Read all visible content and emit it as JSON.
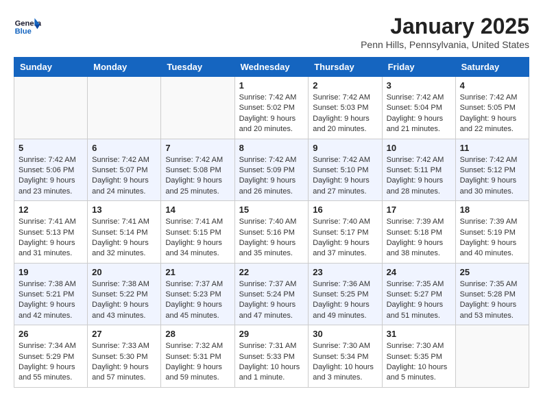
{
  "header": {
    "logo_line1": "General",
    "logo_line2": "Blue",
    "month": "January 2025",
    "location": "Penn Hills, Pennsylvania, United States"
  },
  "weekdays": [
    "Sunday",
    "Monday",
    "Tuesday",
    "Wednesday",
    "Thursday",
    "Friday",
    "Saturday"
  ],
  "weeks": [
    [
      {
        "day": "",
        "info": ""
      },
      {
        "day": "",
        "info": ""
      },
      {
        "day": "",
        "info": ""
      },
      {
        "day": "1",
        "info": "Sunrise: 7:42 AM\nSunset: 5:02 PM\nDaylight: 9 hours\nand 20 minutes."
      },
      {
        "day": "2",
        "info": "Sunrise: 7:42 AM\nSunset: 5:03 PM\nDaylight: 9 hours\nand 20 minutes."
      },
      {
        "day": "3",
        "info": "Sunrise: 7:42 AM\nSunset: 5:04 PM\nDaylight: 9 hours\nand 21 minutes."
      },
      {
        "day": "4",
        "info": "Sunrise: 7:42 AM\nSunset: 5:05 PM\nDaylight: 9 hours\nand 22 minutes."
      }
    ],
    [
      {
        "day": "5",
        "info": "Sunrise: 7:42 AM\nSunset: 5:06 PM\nDaylight: 9 hours\nand 23 minutes."
      },
      {
        "day": "6",
        "info": "Sunrise: 7:42 AM\nSunset: 5:07 PM\nDaylight: 9 hours\nand 24 minutes."
      },
      {
        "day": "7",
        "info": "Sunrise: 7:42 AM\nSunset: 5:08 PM\nDaylight: 9 hours\nand 25 minutes."
      },
      {
        "day": "8",
        "info": "Sunrise: 7:42 AM\nSunset: 5:09 PM\nDaylight: 9 hours\nand 26 minutes."
      },
      {
        "day": "9",
        "info": "Sunrise: 7:42 AM\nSunset: 5:10 PM\nDaylight: 9 hours\nand 27 minutes."
      },
      {
        "day": "10",
        "info": "Sunrise: 7:42 AM\nSunset: 5:11 PM\nDaylight: 9 hours\nand 28 minutes."
      },
      {
        "day": "11",
        "info": "Sunrise: 7:42 AM\nSunset: 5:12 PM\nDaylight: 9 hours\nand 30 minutes."
      }
    ],
    [
      {
        "day": "12",
        "info": "Sunrise: 7:41 AM\nSunset: 5:13 PM\nDaylight: 9 hours\nand 31 minutes."
      },
      {
        "day": "13",
        "info": "Sunrise: 7:41 AM\nSunset: 5:14 PM\nDaylight: 9 hours\nand 32 minutes."
      },
      {
        "day": "14",
        "info": "Sunrise: 7:41 AM\nSunset: 5:15 PM\nDaylight: 9 hours\nand 34 minutes."
      },
      {
        "day": "15",
        "info": "Sunrise: 7:40 AM\nSunset: 5:16 PM\nDaylight: 9 hours\nand 35 minutes."
      },
      {
        "day": "16",
        "info": "Sunrise: 7:40 AM\nSunset: 5:17 PM\nDaylight: 9 hours\nand 37 minutes."
      },
      {
        "day": "17",
        "info": "Sunrise: 7:39 AM\nSunset: 5:18 PM\nDaylight: 9 hours\nand 38 minutes."
      },
      {
        "day": "18",
        "info": "Sunrise: 7:39 AM\nSunset: 5:19 PM\nDaylight: 9 hours\nand 40 minutes."
      }
    ],
    [
      {
        "day": "19",
        "info": "Sunrise: 7:38 AM\nSunset: 5:21 PM\nDaylight: 9 hours\nand 42 minutes."
      },
      {
        "day": "20",
        "info": "Sunrise: 7:38 AM\nSunset: 5:22 PM\nDaylight: 9 hours\nand 43 minutes."
      },
      {
        "day": "21",
        "info": "Sunrise: 7:37 AM\nSunset: 5:23 PM\nDaylight: 9 hours\nand 45 minutes."
      },
      {
        "day": "22",
        "info": "Sunrise: 7:37 AM\nSunset: 5:24 PM\nDaylight: 9 hours\nand 47 minutes."
      },
      {
        "day": "23",
        "info": "Sunrise: 7:36 AM\nSunset: 5:25 PM\nDaylight: 9 hours\nand 49 minutes."
      },
      {
        "day": "24",
        "info": "Sunrise: 7:35 AM\nSunset: 5:27 PM\nDaylight: 9 hours\nand 51 minutes."
      },
      {
        "day": "25",
        "info": "Sunrise: 7:35 AM\nSunset: 5:28 PM\nDaylight: 9 hours\nand 53 minutes."
      }
    ],
    [
      {
        "day": "26",
        "info": "Sunrise: 7:34 AM\nSunset: 5:29 PM\nDaylight: 9 hours\nand 55 minutes."
      },
      {
        "day": "27",
        "info": "Sunrise: 7:33 AM\nSunset: 5:30 PM\nDaylight: 9 hours\nand 57 minutes."
      },
      {
        "day": "28",
        "info": "Sunrise: 7:32 AM\nSunset: 5:31 PM\nDaylight: 9 hours\nand 59 minutes."
      },
      {
        "day": "29",
        "info": "Sunrise: 7:31 AM\nSunset: 5:33 PM\nDaylight: 10 hours\nand 1 minute."
      },
      {
        "day": "30",
        "info": "Sunrise: 7:30 AM\nSunset: 5:34 PM\nDaylight: 10 hours\nand 3 minutes."
      },
      {
        "day": "31",
        "info": "Sunrise: 7:30 AM\nSunset: 5:35 PM\nDaylight: 10 hours\nand 5 minutes."
      },
      {
        "day": "",
        "info": ""
      }
    ]
  ]
}
